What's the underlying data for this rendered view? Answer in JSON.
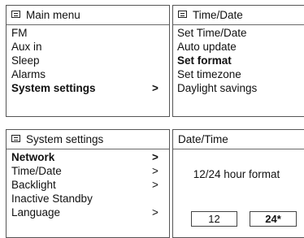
{
  "panels": {
    "main_menu": {
      "title": "Main menu",
      "icon": "menu-icon",
      "items": [
        {
          "label": "FM",
          "arrow": "",
          "bold": false
        },
        {
          "label": "Aux in",
          "arrow": "",
          "bold": false
        },
        {
          "label": "Sleep",
          "arrow": "",
          "bold": false
        },
        {
          "label": "Alarms",
          "arrow": "",
          "bold": false
        },
        {
          "label": "System settings",
          "arrow": ">",
          "bold": true
        }
      ]
    },
    "time_date": {
      "title": "Time/Date",
      "icon": "menu-icon",
      "items": [
        {
          "label": "Set Time/Date",
          "bold": false
        },
        {
          "label": "Auto update",
          "bold": false
        },
        {
          "label": "Set format",
          "bold": true
        },
        {
          "label": "Set timezone",
          "bold": false
        },
        {
          "label": "Daylight savings",
          "bold": false
        }
      ]
    },
    "system_settings": {
      "title": "System settings",
      "icon": "menu-icon",
      "items": [
        {
          "label": "Network",
          "arrow": ">",
          "bold": true
        },
        {
          "label": "Time/Date",
          "arrow": ">",
          "bold": false
        },
        {
          "label": "Backlight",
          "arrow": ">",
          "bold": false
        },
        {
          "label": "Inactive Standby",
          "arrow": "",
          "bold": false
        },
        {
          "label": "Language",
          "arrow": ">",
          "bold": false
        }
      ]
    },
    "date_time_format": {
      "title": "Date/Time",
      "prompt": "12/24 hour format",
      "options": [
        {
          "label": "12",
          "selected": false
        },
        {
          "label": "24*",
          "selected": true
        }
      ]
    }
  }
}
